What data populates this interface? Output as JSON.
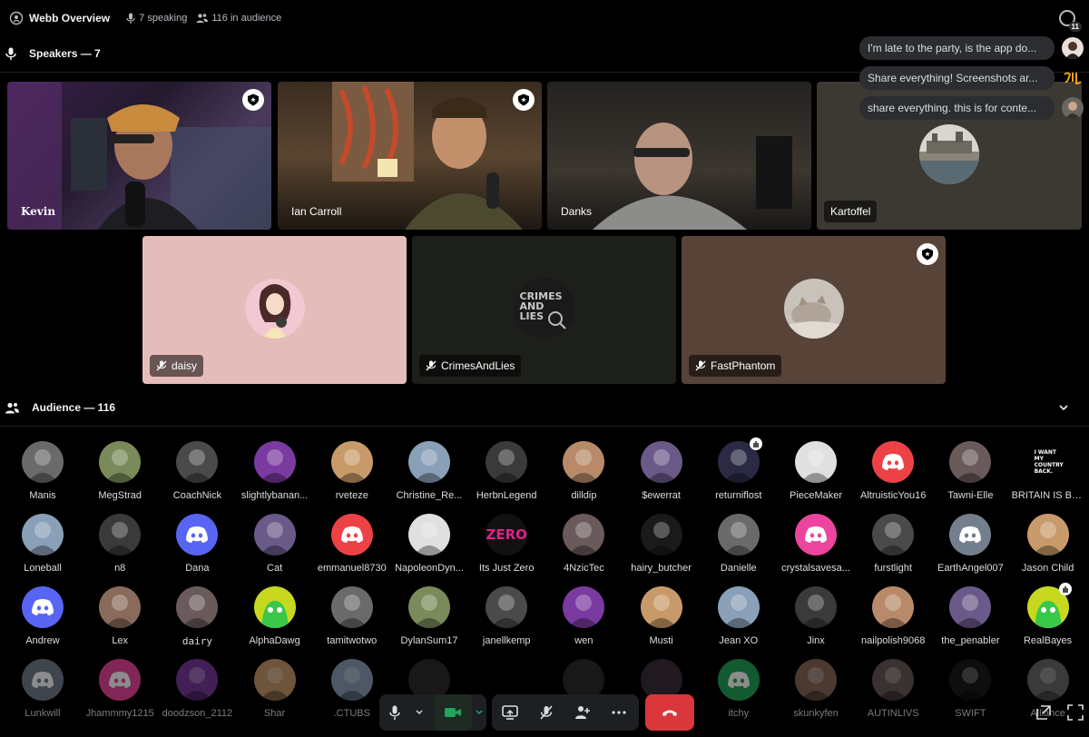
{
  "topbar": {
    "title": "Webb Overview",
    "speaking": "7 speaking",
    "audience_count": "116 in audience",
    "inbox_badge": "11"
  },
  "speakers": {
    "heading": "Speakers — 7",
    "tiles": [
      {
        "name": "Kevin",
        "muted": false,
        "moderator": true
      },
      {
        "name": "Ian Carroll",
        "muted": false,
        "moderator": true
      },
      {
        "name": "Danks",
        "muted": false,
        "moderator": false
      },
      {
        "name": "Kartoffel",
        "muted": false,
        "moderator": false
      },
      {
        "name": "daisy",
        "muted": true,
        "moderator": false
      },
      {
        "name": "CrimesAndLies",
        "muted": true,
        "moderator": false,
        "avatar_text": "CRIMES AND LIES"
      },
      {
        "name": "FastPhantom",
        "muted": true,
        "moderator": true
      }
    ]
  },
  "notifications": [
    {
      "text": "I'm late to the party, is the app do..."
    },
    {
      "text": "Share everything! Screenshots ar..."
    },
    {
      "text": "share everything. this is for conte..."
    }
  ],
  "audience": {
    "heading": "Audience — 116",
    "rows": [
      [
        "Manis",
        "MegStrad",
        "CoachNick",
        "slightlybanan...",
        "rveteze",
        "Christine_Re...",
        "HerbnLegend",
        "dilldip",
        "$ewerrat",
        "returniflost",
        "PieceMaker",
        "AltruisticYou16",
        "Tawni-Elle",
        "BRITAIN IS BR..."
      ],
      [
        "Loneball",
        "n8",
        "Dana",
        "Cat",
        "emmanuel8730",
        "NapoleonDyn...",
        "Its Just Zero",
        "4NzicTec",
        "hairy_butcher",
        "Danielle",
        "crystalsavesa...",
        "furstlight",
        "EarthAngel007",
        "Jason Child"
      ],
      [
        "Andrew",
        "Lex",
        "dairy",
        "AlphaDawg",
        "tamitwotwo",
        "DylanSum17",
        "janellkemp",
        "wen",
        "Musti",
        "Jean XO",
        "Jinx",
        "nailpolish9068",
        "the_penabler",
        "RealBayes"
      ],
      [
        "Lunkwill",
        "Jhammmy1215",
        "doodzson_2112",
        "Shar",
        ".CTUBS",
        "",
        "",
        "",
        "",
        "itchy",
        "skunkyfen",
        "AUTINLIVS",
        "SWIFT",
        "Alliance"
      ]
    ],
    "avatar_text_zero": "ZERO",
    "avatar_text_britain": "I WANT MY COUNTRY BACK."
  },
  "colors": {
    "blurple": "#5865f2",
    "discord_red": "#ed4245",
    "discord_gray": "#747f8d",
    "discord_pink": "#eb459e",
    "leave_red": "#da373c",
    "camera_green": "#23a55a",
    "daisy_tile": "#e4bcb9",
    "crimes_tile": "#1d1f1a",
    "fastphantom_tile": "#574338",
    "kartoffel_tile": "#3b3932"
  },
  "icons": {
    "moderator": "shield-star-icon",
    "muted": "mic-off-icon",
    "mic": "mic-icon",
    "camera": "camera-icon",
    "screen_share": "screen-share-icon",
    "more": "more-dots-icon",
    "leave": "phone-hangup-icon"
  }
}
